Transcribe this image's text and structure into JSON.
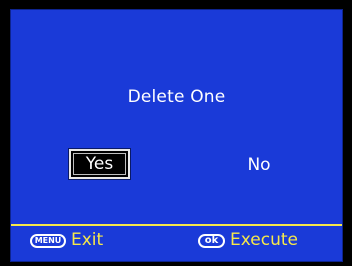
{
  "dialog": {
    "title": "Delete One",
    "options": {
      "yes": "Yes",
      "no": "No"
    },
    "selected": "yes"
  },
  "footer": {
    "menu_key": "MENU",
    "menu_action": "Exit",
    "ok_key": "ok",
    "ok_action": "Execute"
  },
  "colors": {
    "background": "#1a3ad8",
    "text": "#ffffff",
    "accent": "#f6e84a",
    "selection_bg": "#000000"
  },
  "icons": {
    "menu": "menu-key-icon",
    "ok": "ok-key-icon"
  }
}
